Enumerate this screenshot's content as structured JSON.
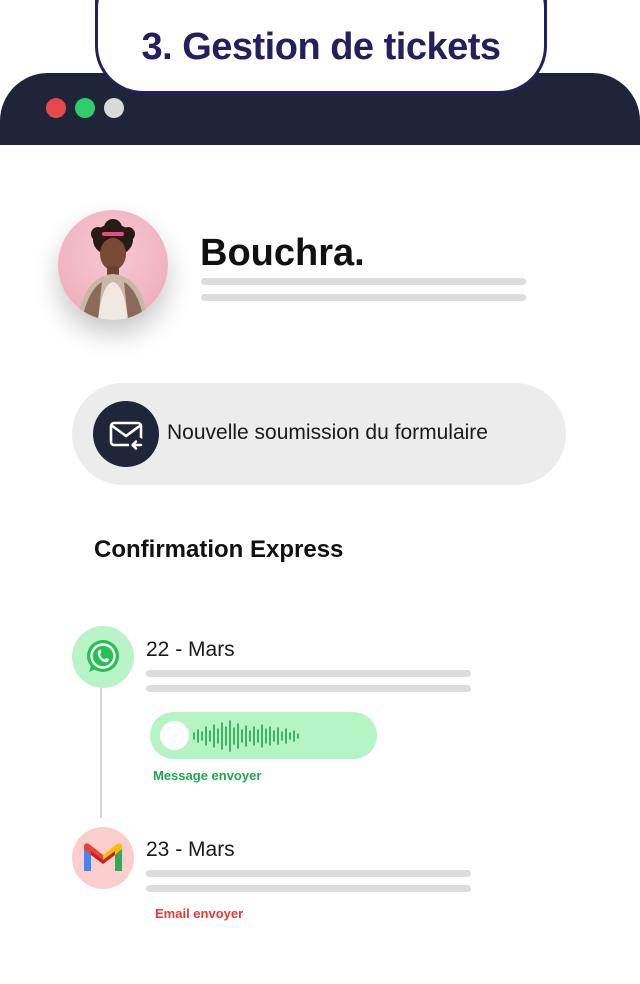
{
  "header": {
    "title": "3. Gestion de tickets"
  },
  "profile": {
    "name": "Bouchra."
  },
  "notification": {
    "text": "Nouvelle soumission du formulaire",
    "icon": "mail-reply-icon"
  },
  "section": {
    "title": "Confirmation Express"
  },
  "timeline": [
    {
      "icon": "whatsapp-icon",
      "date": "22 - Mars",
      "status": "Message envoyer",
      "status_color": "#1fa84a"
    },
    {
      "icon": "gmail-icon",
      "date": "23 - Mars",
      "status": "Email envoyer",
      "status_color": "#e53935"
    }
  ],
  "colors": {
    "title": "#22205e",
    "window_bar": "#1f2438",
    "whatsapp_bg": "#b9f3c8",
    "gmail_bg": "#fbcdcd"
  }
}
